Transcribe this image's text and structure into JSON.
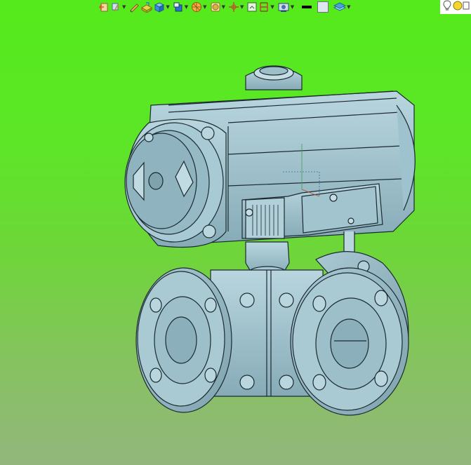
{
  "toolbar": {
    "buttons": [
      {
        "icon": "exit-sketch-icon",
        "color": "#d97c2b"
      },
      {
        "icon": "sketch-plane-icon",
        "color": "#6b8fd6"
      },
      {
        "icon": "pencil-icon",
        "color": "#c9a23c"
      },
      {
        "icon": "extrude-icon",
        "color": "#e5c43a"
      },
      {
        "icon": "box-3d-icon",
        "color": "#3a8fe0"
      },
      {
        "icon": "view-orientation-icon",
        "color": "#2f6fc7"
      },
      {
        "icon": "section-view-icon",
        "color": "#e08a1e"
      },
      {
        "icon": "render-style-icon",
        "color": "#d9b24a"
      },
      {
        "icon": "axis-triad-icon",
        "color": "#c44a2a"
      },
      {
        "icon": "zoom-fit-icon",
        "color": "#3c8a3c"
      },
      {
        "icon": "measure-icon",
        "color": "#c43a3a"
      },
      {
        "icon": "display-settings-icon",
        "color": "#4a6fa8"
      },
      {
        "icon": "edge-color-icon",
        "color": "#000000"
      },
      {
        "icon": "background-color-icon",
        "color": "#dfe6ee"
      },
      {
        "icon": "layers-icon",
        "color": "#4aa0d8"
      }
    ],
    "light_panel": [
      "lightbulb-icon",
      "scene-light-icon"
    ]
  },
  "model": {
    "name_hint": "pneumatic-actuated-three-way-ball-valve",
    "body_color": "#9fc3ce",
    "edge_color": "#1b2a30",
    "background_top": "#55ea1c",
    "background_bottom": "#93b67c"
  }
}
